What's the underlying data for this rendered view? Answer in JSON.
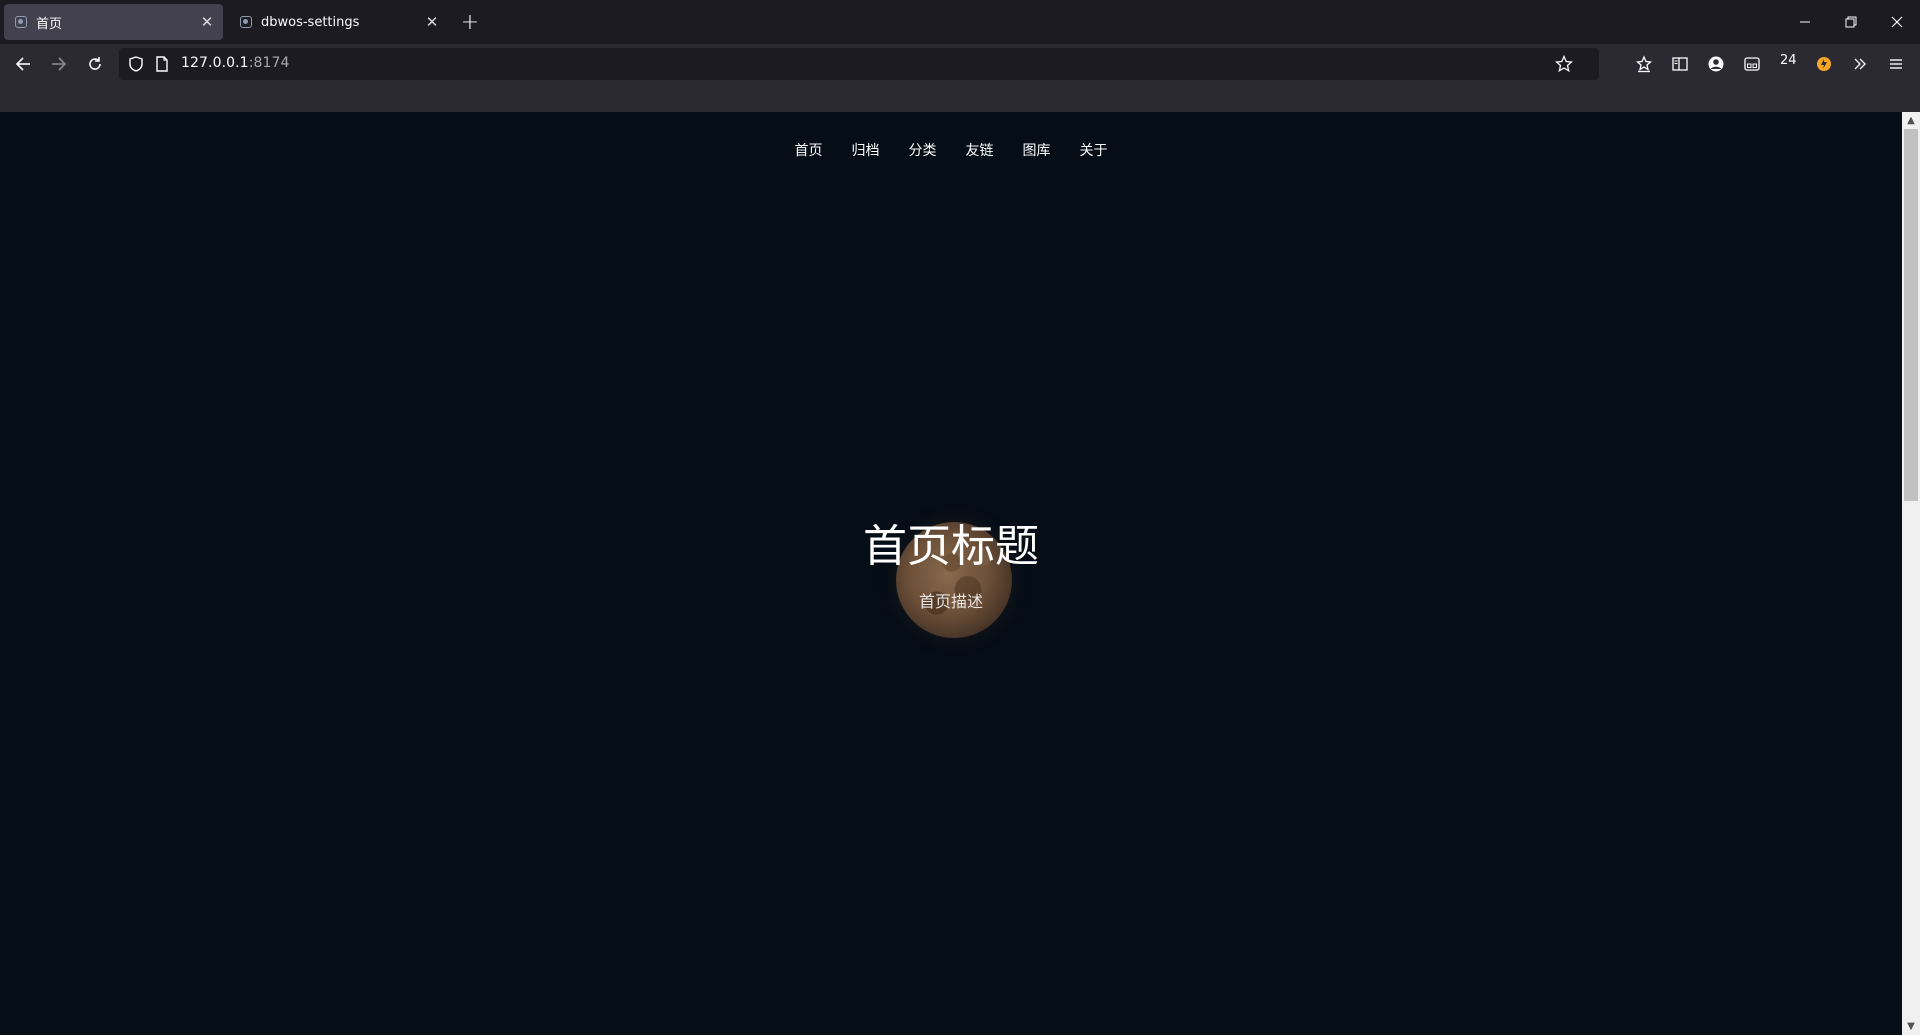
{
  "browser": {
    "tabs": [
      {
        "title": "首页",
        "active": true
      },
      {
        "title": "dbwos-settings",
        "active": false
      }
    ],
    "url": {
      "host": "127.0.0.1",
      "port": ":8174"
    },
    "badge": "24"
  },
  "site": {
    "nav": [
      "首页",
      "归档",
      "分类",
      "友链",
      "图库",
      "关于"
    ],
    "hero": {
      "title": "首页标题",
      "description": "首页描述"
    }
  },
  "colors": {
    "page_background": "#050d17",
    "chrome_tabbar": "#1c1b22",
    "chrome_toolbar": "#2b2a33",
    "accent_extension": "#f5a623"
  }
}
